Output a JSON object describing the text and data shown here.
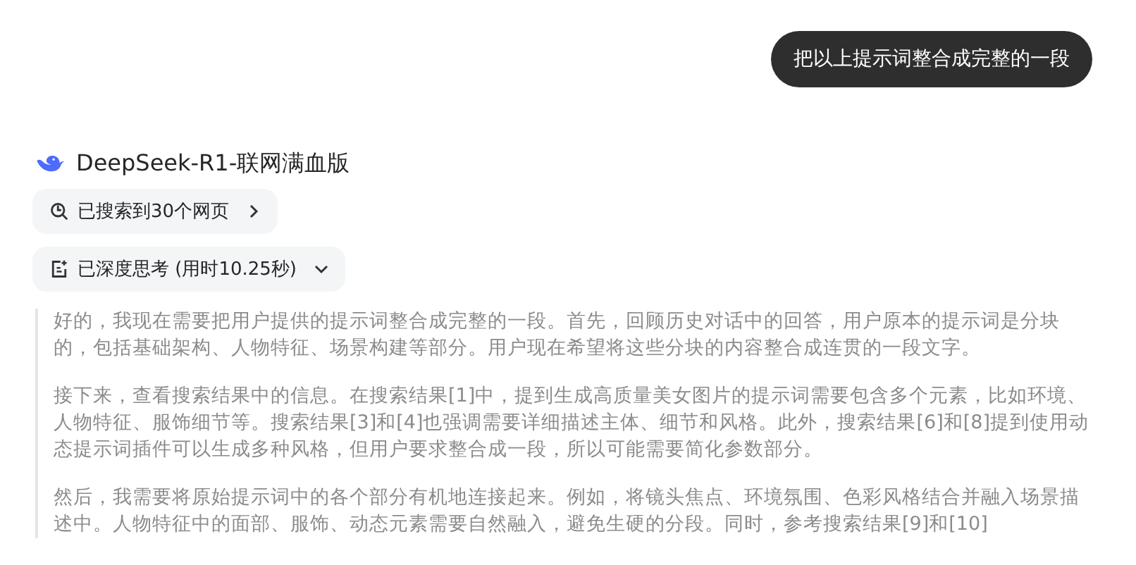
{
  "user_message": {
    "text": "把以上提示词整合成完整的一段"
  },
  "assistant": {
    "name": "DeepSeek-R1-联网满血版",
    "search_chip": {
      "label": "已搜索到30个网页"
    },
    "thinking_chip": {
      "label": "已深度思考 (用时10.25秒)",
      "expanded": true
    },
    "thinking_paragraphs": [
      "好的，我现在需要把用户提供的提示词整合成完整的一段。首先，回顾历史对话中的回答，用户原本的提示词是分块的，包括基础架构、人物特征、场景构建等部分。用户现在希望将这些分块的内容整合成连贯的一段文字。",
      "接下来，查看搜索结果中的信息。在搜索结果[1]中，提到生成高质量美女图片的提示词需要包含多个元素，比如环境、人物特征、服饰细节等。搜索结果[3]和[4]也强调需要详细描述主体、细节和风格。此外，搜索结果[6]和[8]提到使用动态提示词插件可以生成多种风格，但用户要求整合成一段，所以可能需要简化参数部分。",
      "然后，我需要将原始提示词中的各个部分有机地连接起来。例如，将镜头焦点、环境氛围、色彩风格结合并融入场景描述中。人物特征中的面部、服饰、动态元素需要自然融入，避免生硬的分段。同时，参考搜索结果[9]和[10]"
    ]
  }
}
